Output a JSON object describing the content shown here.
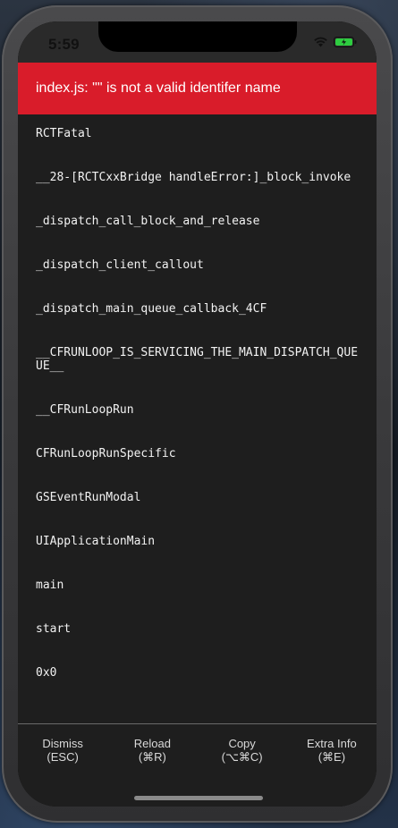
{
  "status_bar": {
    "time": "5:59",
    "wifi_icon": "wifi-icon",
    "battery_icon": "battery-charging-icon",
    "battery_color": "#2ecc40"
  },
  "redbox": {
    "title": "index.js: \"\" is not a valid identifer name",
    "header_color": "#d91c2a"
  },
  "stack_frames": [
    "RCTFatal",
    "__28-[RCTCxxBridge handleError:]_block_invoke",
    "_dispatch_call_block_and_release",
    "_dispatch_client_callout",
    "_dispatch_main_queue_callback_4CF",
    "__CFRUNLOOP_IS_SERVICING_THE_MAIN_DISPATCH_QUEUE__",
    "__CFRunLoopRun",
    "CFRunLoopRunSpecific",
    "GSEventRunModal",
    "UIApplicationMain",
    "main",
    "start",
    "0x0"
  ],
  "actions": {
    "dismiss": {
      "label": "Dismiss",
      "shortcut": "(ESC)"
    },
    "reload": {
      "label": "Reload",
      "shortcut": "(⌘R)"
    },
    "copy": {
      "label": "Copy",
      "shortcut": "(⌥⌘C)"
    },
    "extra": {
      "label": "Extra Info",
      "shortcut": "(⌘E)"
    }
  }
}
